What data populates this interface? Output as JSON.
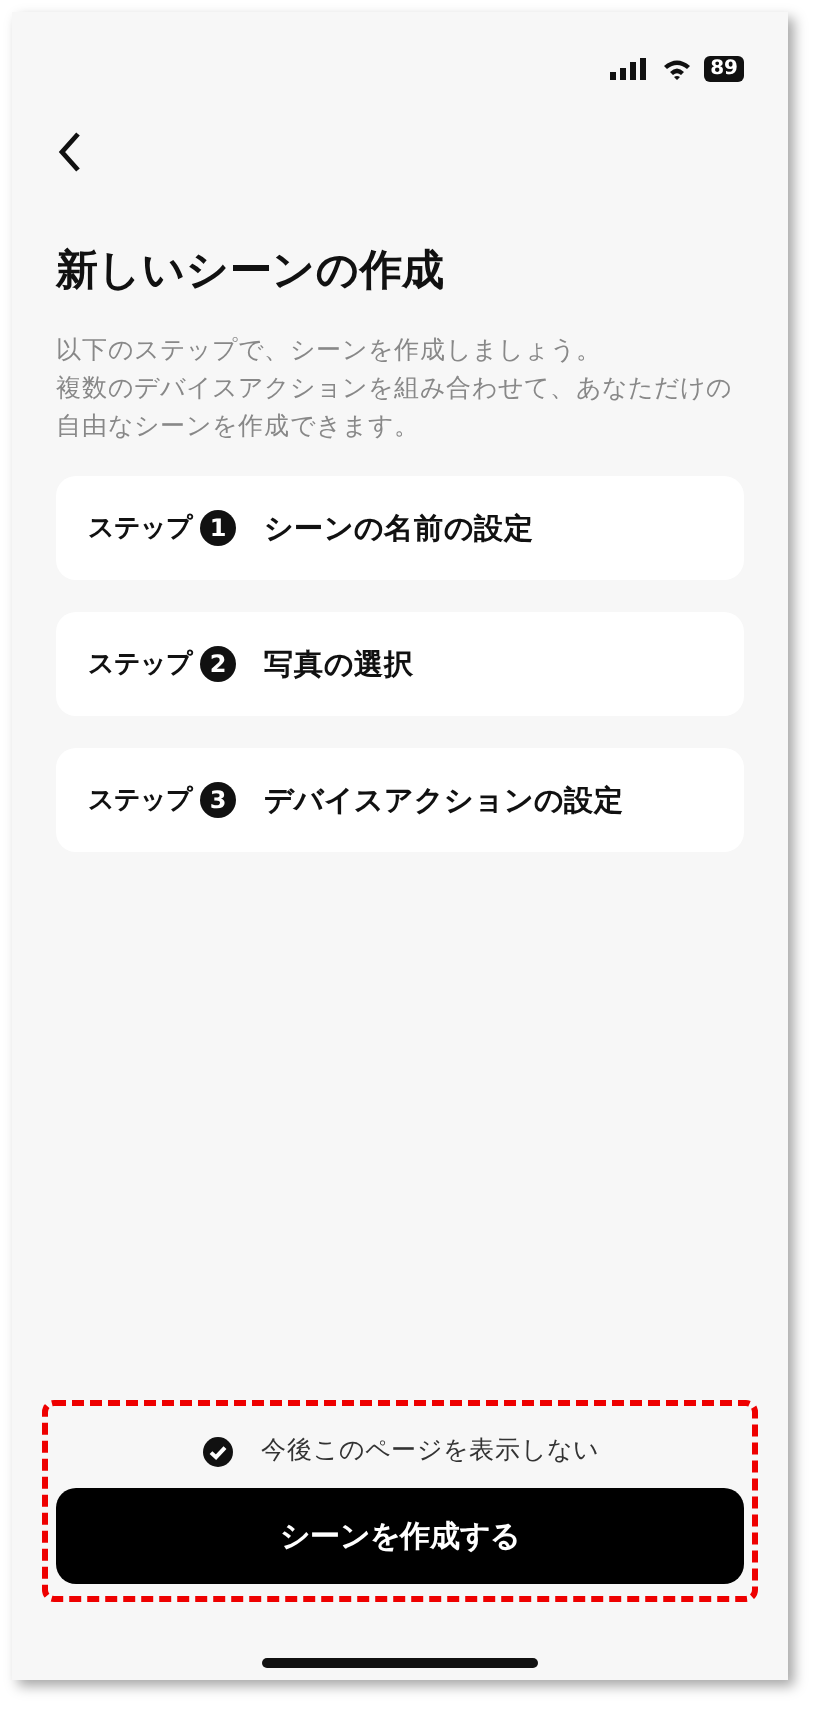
{
  "status_bar": {
    "battery": "89"
  },
  "title": "新しいシーンの作成",
  "description": [
    "以下のステップで、シーンを作成しましょう。",
    "複数のデバイスアクションを組み合わせて、あなただけの自由なシーンを作成できます。"
  ],
  "steps": [
    {
      "label": "ステップ",
      "number": "1",
      "text": "シーンの名前の設定"
    },
    {
      "label": "ステップ",
      "number": "2",
      "text": "写真の選択"
    },
    {
      "label": "ステップ",
      "number": "3",
      "text": "デバイスアクションの設定"
    }
  ],
  "dont_show_again": {
    "label": "今後このページを表示しない",
    "checked": true
  },
  "create_button": "シーンを作成する"
}
